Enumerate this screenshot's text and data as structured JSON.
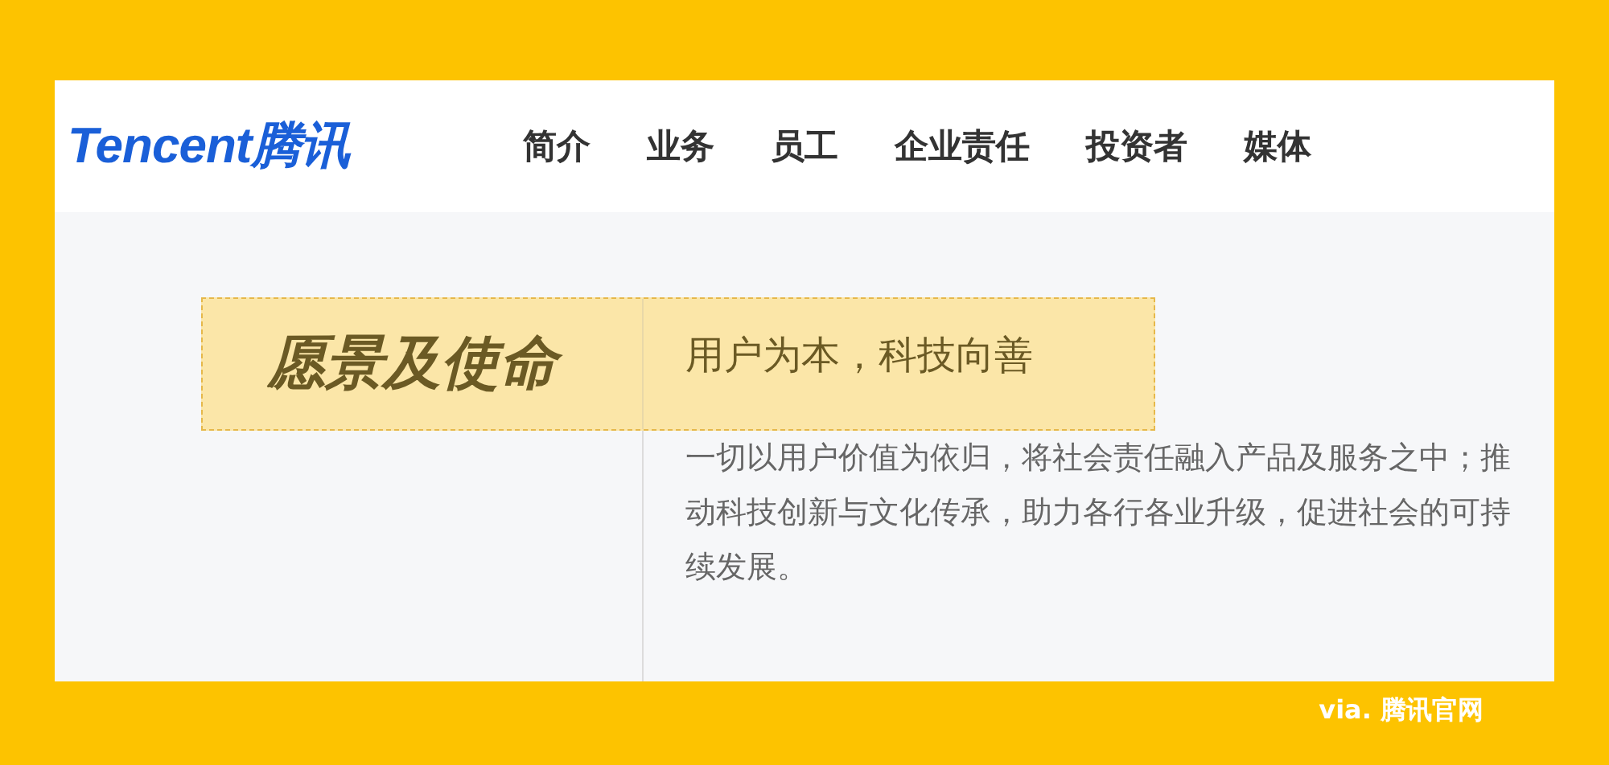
{
  "header": {
    "logo": {
      "latin": "Tencent",
      "cjk": "腾讯"
    },
    "nav": [
      "简介",
      "业务",
      "员工",
      "企业责任",
      "投资者",
      "媒体"
    ]
  },
  "mission": {
    "title": "愿景及使命",
    "subtitle": "用户为本，科技向善",
    "description": "一切以用户价值为依归，将社会责任融入产品及服务之中；推动科技创新与文化传承，助力各行各业升级，促进社会的可持续发展。"
  },
  "caption": "via. 腾讯官网"
}
